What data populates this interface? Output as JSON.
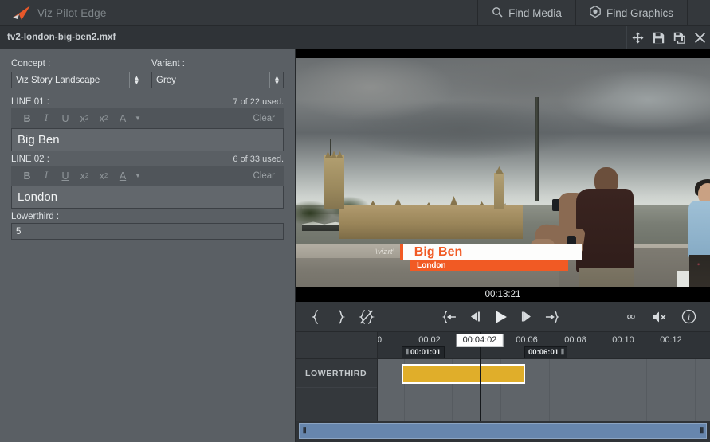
{
  "app": {
    "brand": "Viz Pilot Edge",
    "logo_icon": "orange-arrow-logo"
  },
  "header": {
    "tabs": [
      {
        "label": "Find Media",
        "icon": "search-icon"
      },
      {
        "label": "Find Graphics",
        "icon": "graphics-hexagon-icon"
      }
    ]
  },
  "document": {
    "title": "tv2-london-big-ben2.mxf",
    "actions": [
      {
        "name": "move-handle",
        "icon": "move-arrows-icon"
      },
      {
        "name": "save",
        "icon": "floppy-save-icon"
      },
      {
        "name": "save-as",
        "icon": "floppy-save-as-icon"
      },
      {
        "name": "close",
        "icon": "close-x-icon"
      }
    ]
  },
  "form": {
    "concept": {
      "label": "Concept :",
      "value": "Viz Story Landscape",
      "options": [
        "Viz Story Landscape"
      ]
    },
    "variant": {
      "label": "Variant :",
      "value": "Grey",
      "options": [
        "Grey"
      ]
    },
    "rich_text_buttons": [
      {
        "name": "bold",
        "glyph": "B"
      },
      {
        "name": "italic",
        "glyph": "I"
      },
      {
        "name": "underline",
        "glyph": "U"
      },
      {
        "name": "subscript",
        "glyph": "x"
      },
      {
        "name": "superscript",
        "glyph": "x"
      },
      {
        "name": "text-color",
        "glyph": "A"
      }
    ],
    "clear_label": "Clear",
    "lines": [
      {
        "label": "LINE 01 :",
        "used": "7 of 22 used.",
        "value": "Big Ben"
      },
      {
        "label": "LINE 02 :",
        "used": "6 of 33 used.",
        "value": "London"
      }
    ],
    "lowerthird": {
      "label": "Lowerthird :",
      "value": "5"
    }
  },
  "player": {
    "timecode": "00:13:21",
    "overlay": {
      "brand": "\\vizrt\\",
      "title": "Big Ben",
      "subtitle": "London"
    },
    "transport_left": [
      {
        "name": "mark-in",
        "glyph": "{"
      },
      {
        "name": "mark-out",
        "glyph": "}"
      },
      {
        "name": "clear-marks",
        "glyph": "clear-marks-icon"
      }
    ],
    "transport_center": [
      {
        "name": "go-to-start",
        "glyph": "go-to-start-icon"
      },
      {
        "name": "step-backward",
        "glyph": "step-backward-icon"
      },
      {
        "name": "play",
        "glyph": "play-icon"
      },
      {
        "name": "step-forward",
        "glyph": "step-forward-icon"
      },
      {
        "name": "go-to-end",
        "glyph": "go-to-end-icon"
      }
    ],
    "transport_right": [
      {
        "name": "loop",
        "glyph": "∞"
      },
      {
        "name": "mute",
        "glyph": "mute-icon"
      },
      {
        "name": "info",
        "glyph": "i"
      }
    ]
  },
  "timeline": {
    "track_name": "LOWERTHIRD",
    "playhead": "00:04:02",
    "ruler_ticks": [
      "0",
      "00:02",
      "00:04",
      "00:06",
      "00:08",
      "00:10",
      "00:12"
    ],
    "mark_in": "00:01:01",
    "mark_out": "00:06:01",
    "grip_glyph": "⦀"
  },
  "colors": {
    "accent_orange": "#f15a24",
    "clip_gold": "#e0ae2a",
    "scrollbar_blue": "#6786ad",
    "panel_grey": "#5a5f64",
    "chrome_dark": "#34383c"
  }
}
